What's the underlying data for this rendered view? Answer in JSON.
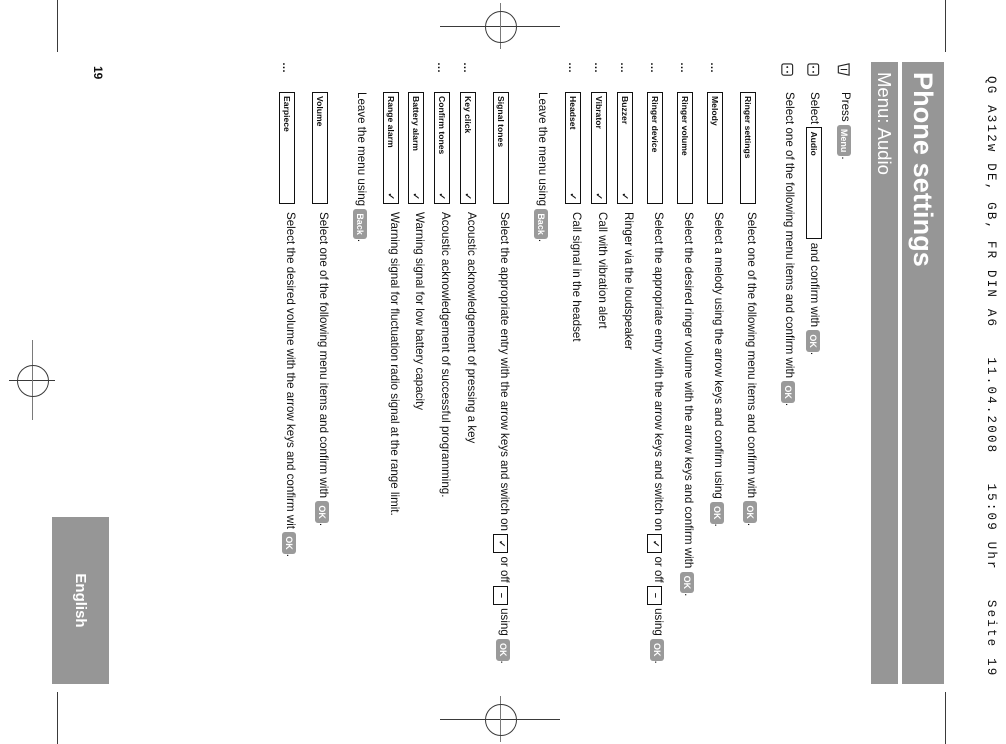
{
  "sheet": {
    "prepress_header": "QG A312w DE, GB, FR DIN A6   11.04.2008   15:09 Uhr   Seite 19"
  },
  "page": {
    "title": "Phone settings",
    "subtitle": "Menu: Audio",
    "language_tab": "English",
    "page_number": "19"
  },
  "keys": {
    "menu": "Menu",
    "ok": "OK",
    "back": "Back",
    "on_symbol": "✓",
    "off_symbol": "–",
    "tick": "✓",
    "ellipsis": "…"
  },
  "steps": [
    {
      "icon": "softkey-icon",
      "text_before": "Press",
      "pill": "Menu",
      "text_after": "."
    },
    {
      "icon": "nav-key-icon",
      "text_before": "Select",
      "box": "Audio",
      "text_after": "and confirm with",
      "pill": "OK",
      "text_end": "."
    },
    {
      "icon": "nav-key-icon",
      "text_before": "Select one of the following menu items and confirm with",
      "pill": "OK",
      "text_end": "."
    }
  ],
  "sections": [
    {
      "id": "ringer-settings",
      "label": "Ringer settings",
      "description_parts": [
        "Select one of the following menu items and confirm with ",
        "OK",
        "."
      ],
      "items": [
        {
          "label": "Melody",
          "tick": "",
          "description_parts": [
            "Select a melody using the arrow keys and confirm using ",
            "OK",
            "."
          ]
        },
        {
          "label": "Ringer volume",
          "tick": "",
          "description_parts": [
            "Select the desired ringer volume with the arrow keys and confirm with ",
            "OK",
            "."
          ]
        },
        {
          "label": "Ringer device",
          "tick": "",
          "description_parts": [
            "Select the appropriate entry with the arrow keys and switch on ",
            "✓",
            " or off ",
            "–",
            " using ",
            "OK",
            "."
          ],
          "subitems": [
            {
              "label": "Buzzer",
              "tick": "✓",
              "description": "Ringer via the loudspeaker"
            },
            {
              "label": "Vibrator",
              "tick": "✓",
              "description": "Call with vibration alert"
            },
            {
              "label": "Headset",
              "tick": "✓",
              "description": "Call signal in the headset"
            }
          ],
          "footer_parts": [
            "Leave the menu using ",
            "Back",
            "."
          ]
        }
      ]
    },
    {
      "id": "signal-tones",
      "label": "Signal tones",
      "description_parts": [
        "Select the appropriate entry with the arrow keys and switch on ",
        "✓",
        " or off ",
        "–",
        " using ",
        "OK",
        "."
      ],
      "subitems": [
        {
          "label": "Key click",
          "tick": "✓",
          "description": "Acoustic acknowledgement of pressing a key"
        },
        {
          "label": "Confirm tones",
          "tick": "✓",
          "description": "Acoustic acknowledgement of successful programming."
        },
        {
          "label": "Battery alarm",
          "tick": "✓",
          "description": "Warning signal for low battery capacity"
        },
        {
          "label": "Range alarm",
          "tick": "✓",
          "description": "Warning signal for fluctuation radio signal at the range limit."
        }
      ],
      "footer_parts": [
        "Leave the menu using ",
        "Back",
        "."
      ]
    },
    {
      "id": "volume",
      "label": "Volume",
      "description_parts": [
        "Select one of the following menu items and confirm with ",
        "OK",
        "."
      ],
      "subitems": [
        {
          "label": "Earpiece",
          "tick": "",
          "description_parts": [
            "Select the desired volume with the arrow keys and confirm wit ",
            "OK",
            "."
          ]
        }
      ]
    }
  ]
}
